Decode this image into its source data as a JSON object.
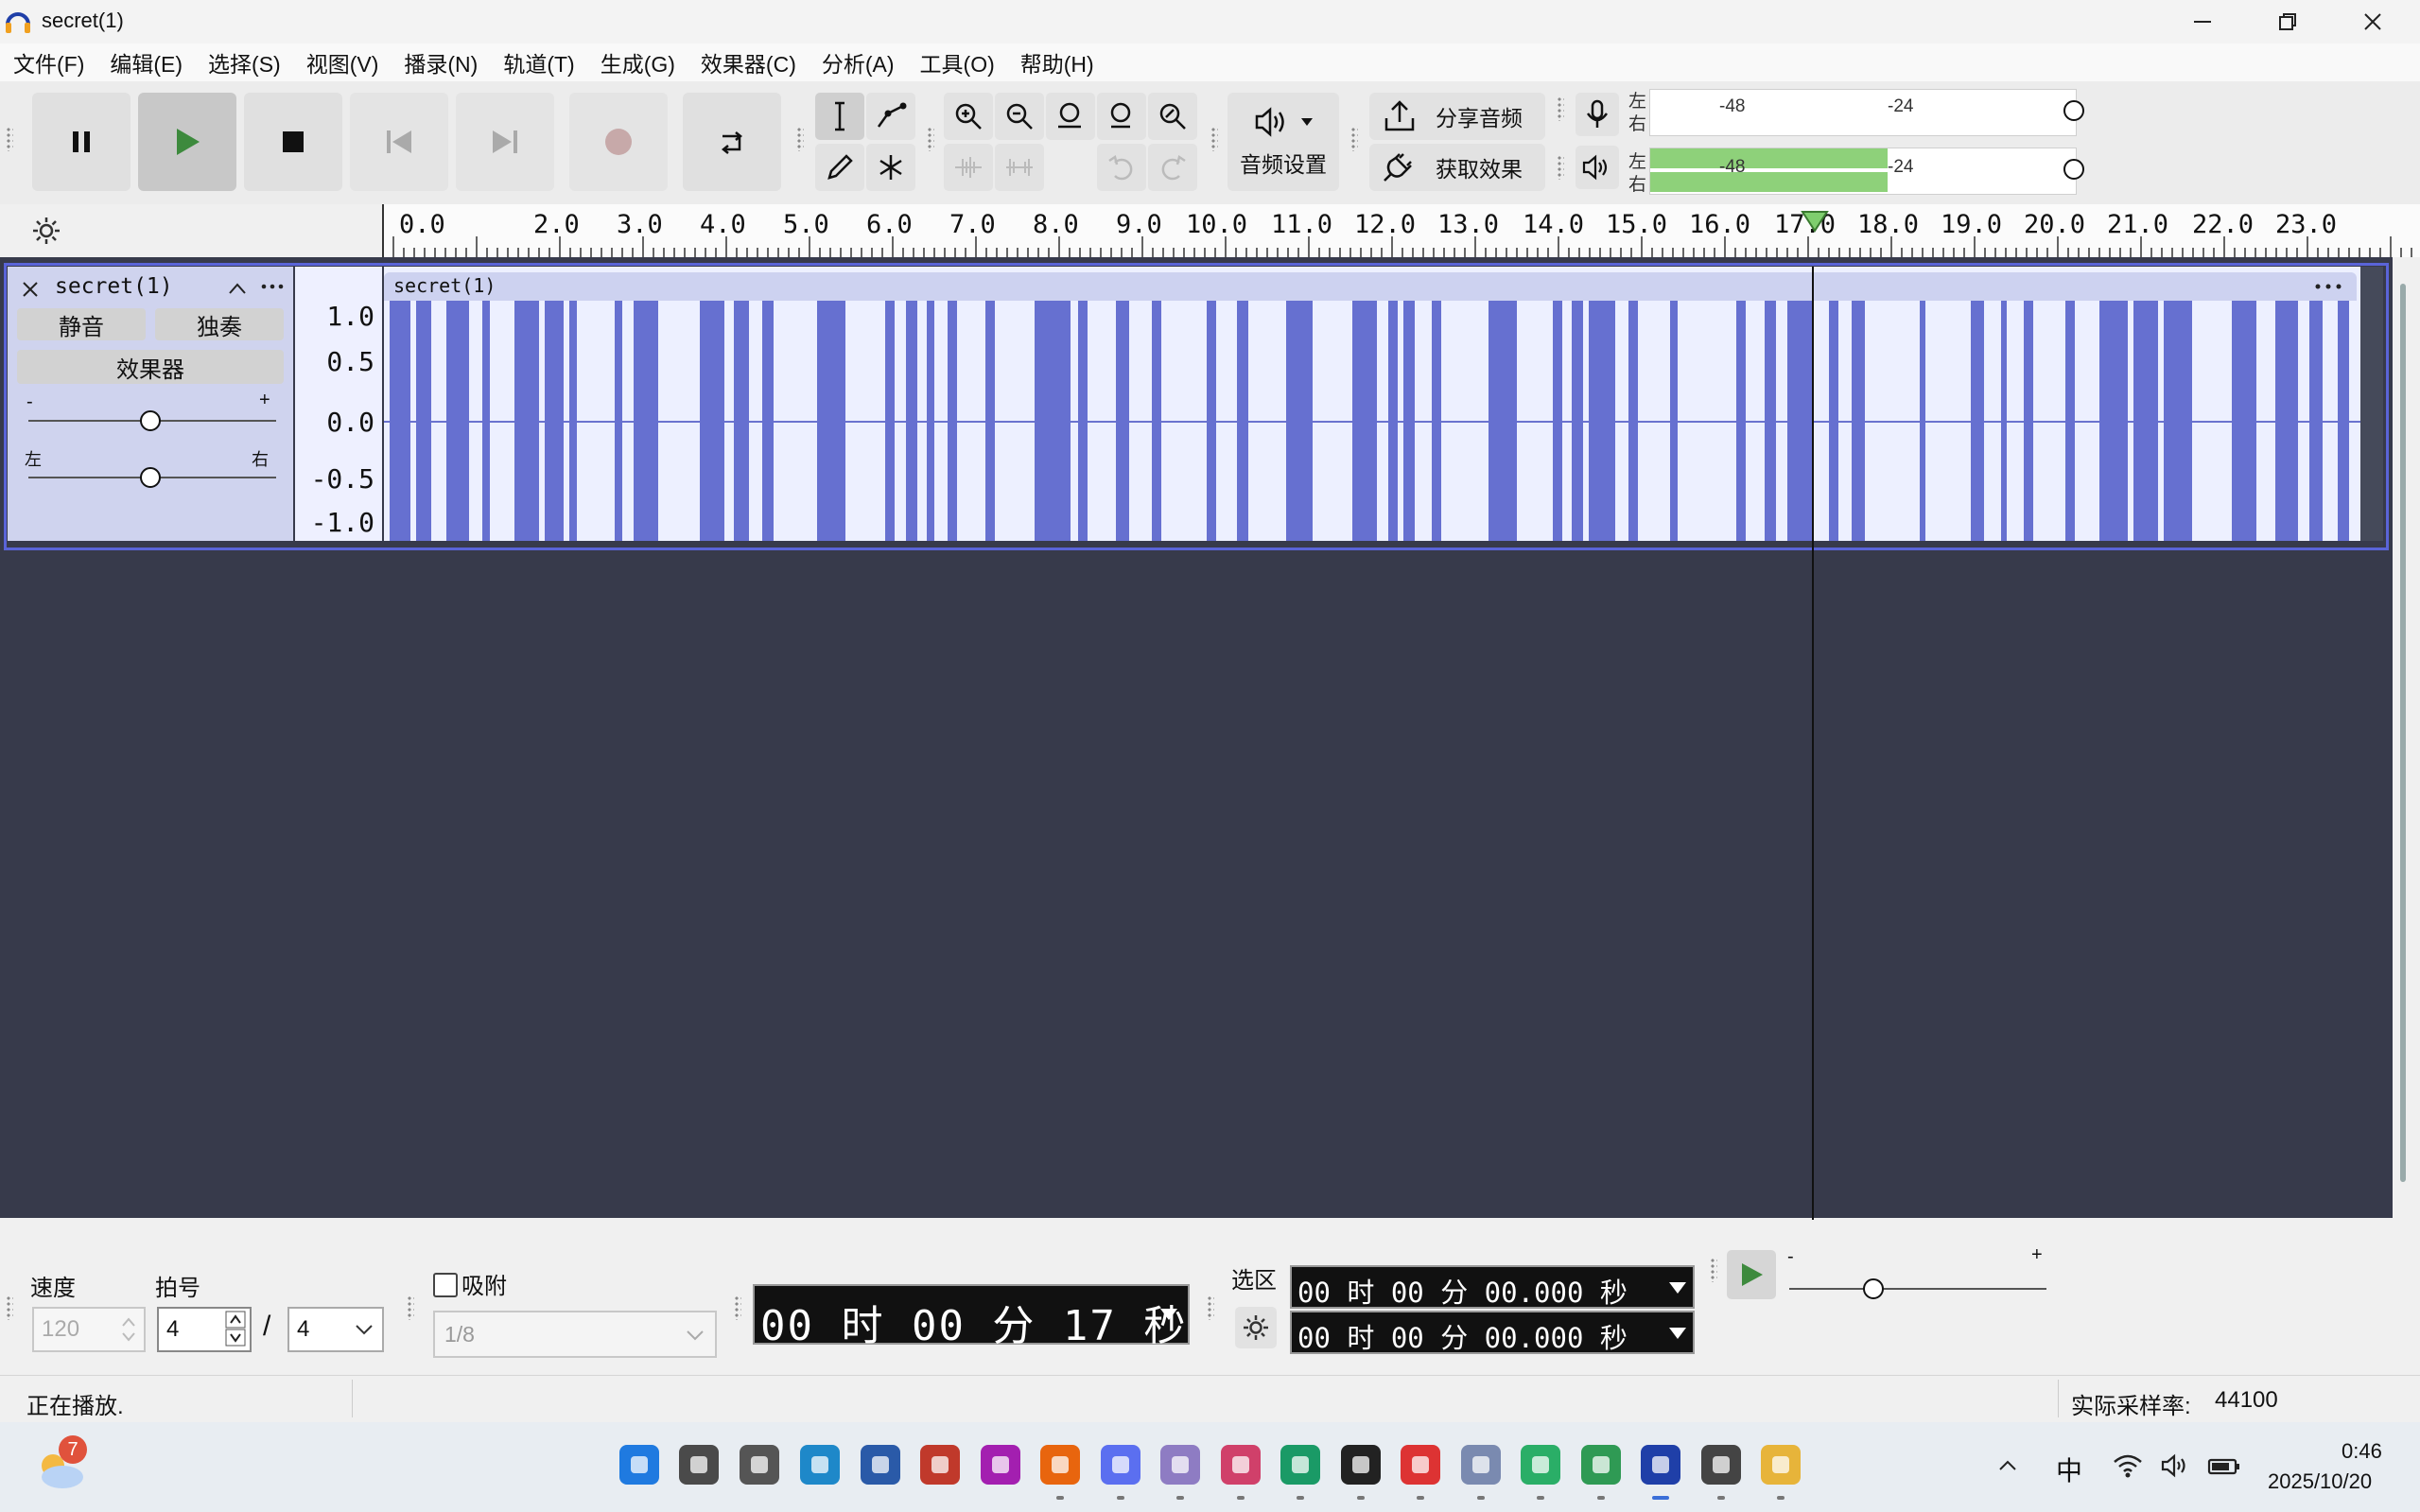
{
  "window": {
    "title": "secret(1)",
    "minimize_icon": "minimize-icon",
    "maximize_icon": "restore-icon",
    "close_icon": "close-icon"
  },
  "menu": [
    "文件(F)",
    "编辑(E)",
    "选择(S)",
    "视图(V)",
    "播录(N)",
    "轨道(T)",
    "生成(G)",
    "效果器(C)",
    "分析(A)",
    "工具(O)",
    "帮助(H)"
  ],
  "toolbar": {
    "audio_setup": "音频设置",
    "share_audio": "分享音频",
    "get_effects": "获取效果",
    "meter": {
      "left": "左",
      "right": "右",
      "tick_48": "-48",
      "tick_24": "-24",
      "playback_level": 0.56
    }
  },
  "ruler": {
    "ticks": [
      "0.0",
      "2.0",
      "3.0",
      "4.0",
      "5.0",
      "6.0",
      "7.0",
      "8.0",
      "9.0",
      "10.0",
      "11.0",
      "12.0",
      "13.0",
      "14.0",
      "15.0",
      "16.0",
      "17.0",
      "18.0",
      "19.0",
      "20.0",
      "21.0",
      "22.0",
      "23.0"
    ]
  },
  "track": {
    "name": "secret(1)",
    "mute": "静音",
    "solo": "独奏",
    "effects": "效果器",
    "gain_minus": "-",
    "gain_plus": "+",
    "pan_left": "左",
    "pan_right": "右",
    "clip_name": "secret(1)",
    "scale": [
      "1.0",
      "0.5",
      "0.0",
      "-0.5",
      "-1.0"
    ]
  },
  "bottom": {
    "tempo_label": "速度",
    "tempo_value": "120",
    "timesig_label": "拍号",
    "timesig_num": "4",
    "timesig_slash": "/",
    "timesig_den": "4",
    "snap_label": "吸附",
    "snap_value": "1/8",
    "time_display": "00 时 00 分 17 秒",
    "selection_label": "选区",
    "sel_start": "00 时 00 分 00.000 秒",
    "sel_end": "00 时 00 分 00.000 秒",
    "speed_minus": "-",
    "speed_plus": "+"
  },
  "status": {
    "text": "正在播放.",
    "rate_label": "实际采样率:",
    "rate_value": "44100"
  },
  "taskbar": {
    "weather_badge": "7",
    "ime": "中",
    "time": "0:46",
    "date": "2025/10/20"
  }
}
